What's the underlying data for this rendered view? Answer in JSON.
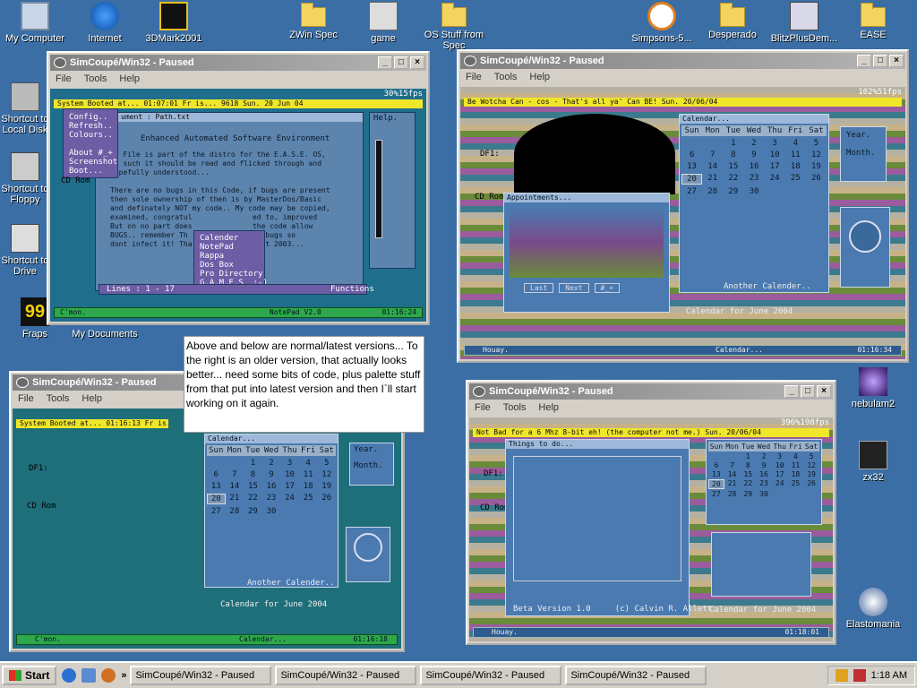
{
  "desktop": {
    "icons": [
      {
        "label": "My Computer"
      },
      {
        "label": "Internet"
      },
      {
        "label": "3DMark2001"
      },
      {
        "label": "ZWin Spec"
      },
      {
        "label": "game"
      },
      {
        "label": "OS Stuff from Spec"
      },
      {
        "label": "Simpsons-5..."
      },
      {
        "label": "Desperado"
      },
      {
        "label": "BlitzPlusDem..."
      },
      {
        "label": "EASE"
      },
      {
        "label": "Shortcut to Local Disk"
      },
      {
        "label": "Shortcut to Floppy"
      },
      {
        "label": "Shortcut to Drive"
      },
      {
        "label": "Fraps"
      },
      {
        "label": "My Documents"
      },
      {
        "label": "nebulam2"
      },
      {
        "label": "zx32"
      },
      {
        "label": "Elastomania"
      }
    ]
  },
  "windows": {
    "title": "SimCoupé/Win32 - Paused",
    "menu": [
      "File",
      "Tools",
      "Help"
    ],
    "w1": {
      "status": "System Booted at... 01:07:01   Fr is... 9618        Sun. 20 Jun 04",
      "fps": "30%15fps",
      "menu_items": [
        "Config..",
        "Refresh..",
        "Colours..",
        "About #_+",
        "Screenshot",
        "Boot..."
      ],
      "doc_title": "ument : Path.txt",
      "help_title": "Help.",
      "heading": "Enhanced Automated Software Environment",
      "body": "is File is part of the distro for the E.A.S.E. OS,\nas such it should be read and flicked through and\nhopefully understood...\n\nThere are no bugs in this Code, if bugs are present\nthen sole ownership of then is by MasterDos/Basic\nand definately NOT my code.. My code may be copied,\nexamined, congratul              ed to, improved\nBut on no part does              the code allow\nBUGS.. remember Th              ude bugs so\ndont infect it! Tha              21st 2003...",
      "popup": [
        "Calender",
        "NotePad",
        "Rappa",
        "Dos Box",
        "Pro Directory",
        "G.A.M.E.S  :-)"
      ],
      "lines": "Lines : 1 - 17",
      "functions": "Functions",
      "bottom_left": "C'mon.",
      "bottom_mid": "NotePad V2.0",
      "time": "01:16:24",
      "side": "CD Rom"
    },
    "w2": {
      "status": "Be Wotcha Can - cos - That's all ya' Can BE!                Sun. 20/06/04",
      "fps": "102%51fps",
      "calendar_title": "Calendar...",
      "appointments_title": "Appointments...",
      "year": "Year.",
      "month": "Month.",
      "last": "Last",
      "next": "Next",
      "hash": "#_+",
      "another": "Another Calender..",
      "cal_footer": "Calendar for June 2004",
      "bottom_left": "Houay.",
      "bottom_mid": "Calendar...",
      "time": "01:16:34",
      "df": "DF1:",
      "cd": "CD Rom"
    },
    "w3": {
      "status": "System Booted at... 01:16:13    Fr is...",
      "calendar_title": "Calendar...",
      "year": "Year.",
      "month": "Month.",
      "another": "Another Calender..",
      "cal_footer": "Calendar for June 2004",
      "bottom_left": "C'mon.",
      "bottom_mid": "Calendar...",
      "time": "01:16:18",
      "df": "DF1:",
      "cd": "CD Rom"
    },
    "w4": {
      "status": "Not  Bad for a 6 Mhz 8-bit eh! (the computer not me.)        Sun. 20/06/04",
      "fps": "396%198fps",
      "things_title": "Things to do...",
      "version": "Beta Version 1.0     (c) Calvin R. Allett.",
      "cal_footer": "Calendar for June 2004",
      "bottom_left": "Houay.",
      "time": "01:18:01",
      "df": "DF1:",
      "cd": "CD Rom"
    }
  },
  "calendar": {
    "days": [
      "Sun",
      "Mon",
      "Tue",
      "Wed",
      "Thu",
      "Fri",
      "Sat"
    ],
    "cells": [
      "",
      "",
      "1",
      "2",
      "3",
      "4",
      "5",
      "6",
      "7",
      "8",
      "9",
      "10",
      "11",
      "12",
      "13",
      "14",
      "15",
      "16",
      "17",
      "18",
      "19",
      "20",
      "21",
      "22",
      "23",
      "24",
      "25",
      "26",
      "27",
      "28",
      "29",
      "30",
      "",
      "",
      ""
    ]
  },
  "note": "Above and below are normal/latest versions... To the right is an older version, that actually looks better... need some bits of code, plus palette stuff from that put into latest version and then I`ll start working on it again.",
  "taskbar": {
    "start": "Start",
    "tasks": [
      "SimCoupé/Win32 - Paused",
      "SimCoupé/Win32 - Paused",
      "SimCoupé/Win32 - Paused",
      "SimCoupé/Win32 - Paused"
    ],
    "clock": "1:18 AM",
    "chevron": "»"
  }
}
